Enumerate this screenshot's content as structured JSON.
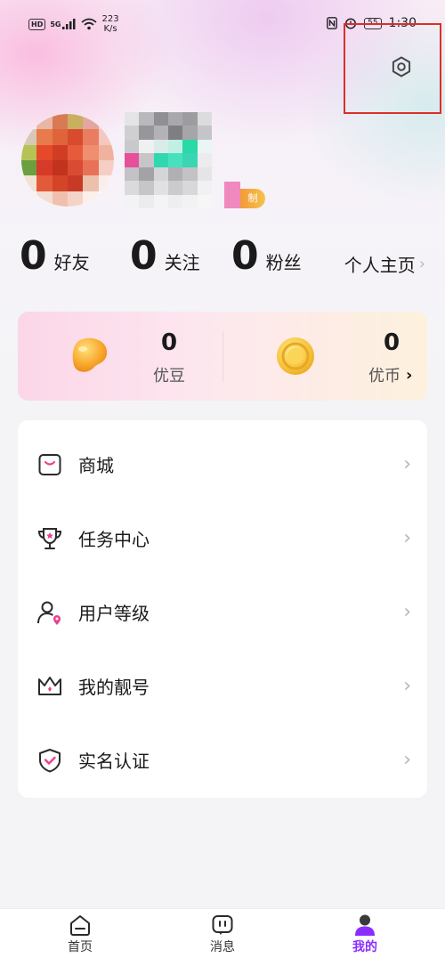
{
  "status_bar": {
    "hd": "HD",
    "network": "5G",
    "speed_value": "223",
    "speed_unit": "K/s",
    "battery": "55",
    "time": "1:30"
  },
  "profile": {
    "level_badge": "制"
  },
  "stats": {
    "friends": {
      "count": "0",
      "label": "好友"
    },
    "following": {
      "count": "0",
      "label": "关注"
    },
    "fans": {
      "count": "0",
      "label": "粉丝"
    },
    "home_link": "个人主页"
  },
  "wallet": {
    "beans": {
      "count": "0",
      "label": "优豆"
    },
    "coins": {
      "count": "0",
      "label": "优币"
    }
  },
  "menu": {
    "items": [
      {
        "label": "商城",
        "icon": "shop-bag-icon"
      },
      {
        "label": "任务中心",
        "icon": "trophy-icon"
      },
      {
        "label": "用户等级",
        "icon": "user-level-icon"
      },
      {
        "label": "我的靓号",
        "icon": "crown-icon"
      },
      {
        "label": "实名认证",
        "icon": "shield-check-icon"
      }
    ]
  },
  "tabbar": {
    "tabs": [
      {
        "label": "首页",
        "icon": "home-icon"
      },
      {
        "label": "消息",
        "icon": "message-icon"
      },
      {
        "label": "我的",
        "icon": "profile-icon",
        "active": true
      }
    ]
  },
  "colors": {
    "accent": "#e8418f",
    "tab_active": "#8b2cff",
    "highlight_box": "#d9302a"
  }
}
